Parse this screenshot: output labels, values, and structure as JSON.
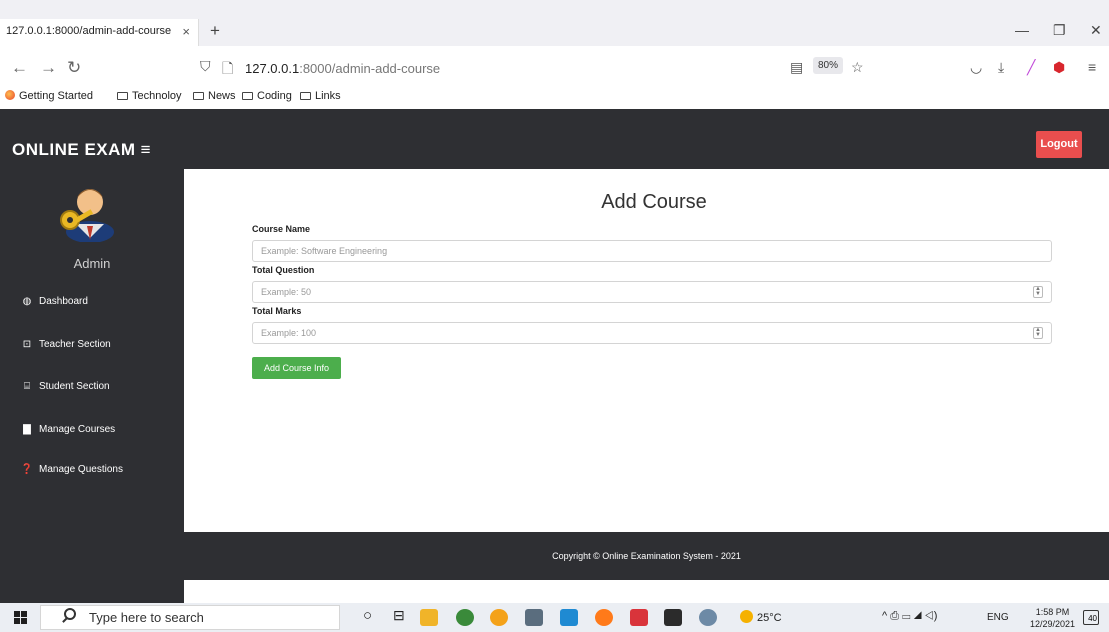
{
  "browser": {
    "tab_title": "127.0.0.1:8000/admin-add-course",
    "tab_close": "×",
    "new_tab": "+",
    "url_host": "127.0.0.1",
    "url_path": ":8000/admin-add-course",
    "zoom": "80%",
    "bookmarks": [
      "Getting Started",
      "Technoloy",
      "News",
      "Coding",
      "Links"
    ]
  },
  "header": {
    "brand": "ONLINE EXAM",
    "menu_glyph": "≡",
    "logout_label": "Logout"
  },
  "sidebar": {
    "user_name": "Admin",
    "items": [
      {
        "label": "Dashboard",
        "icon": "dashboard-icon"
      },
      {
        "label": "Teacher Section",
        "icon": "chalkboard-teacher-icon"
      },
      {
        "label": "Student Section",
        "icon": "graduation-cap-icon"
      },
      {
        "label": "Manage Courses",
        "icon": "book-icon"
      },
      {
        "label": "Manage Questions",
        "icon": "question-circle-icon"
      }
    ]
  },
  "main": {
    "title": "Add Course",
    "fields": [
      {
        "label": "Course Name",
        "placeholder": "Example: Software Engineering"
      },
      {
        "label": "Total Question",
        "placeholder": "Example: 50"
      },
      {
        "label": "Total Marks",
        "placeholder": "Example: 100"
      }
    ],
    "submit_label": "Add Course Info"
  },
  "footer": {
    "copyright": "Copyright © Online Examination System - 2021"
  },
  "taskbar": {
    "search_placeholder": "Type here to search",
    "temperature": "25°C",
    "language": "ENG",
    "time": "1:58 PM",
    "date": "12/29/2021",
    "notification_count": "40"
  },
  "colors": {
    "dark_bg": "#2e2f33",
    "logout": "#e94e4e",
    "submit": "#4cae4c"
  }
}
